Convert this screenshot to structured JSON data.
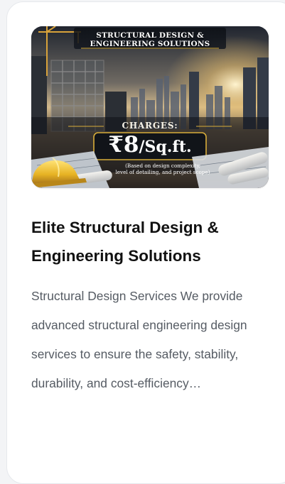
{
  "card": {
    "image": {
      "banner_title_line1": "STRUCTURAL DESIGN &",
      "banner_title_line2": "ENGINEERING SOLUTIONS",
      "charges_label": "CHARGES:",
      "price_amount": "₹8",
      "price_unit": "/Sq.ft.",
      "price_note_line1": "(Based on design complexity,",
      "price_note_line2": "level of detailing, and project scope)"
    },
    "title": "Elite Structural Design & Engineering Solutions",
    "excerpt": "Structural Design Services We provide advanced structural engineering design services to ensure the safety, stability, durability, and cost-efficiency…"
  },
  "colors": {
    "card_background": "#ffffff",
    "page_background": "#f3f4f6",
    "title": "#111111",
    "excerpt": "#555b63",
    "banner_gold": "#d8ad3a"
  },
  "icons": {
    "helmet": "yellow-safety-helmet-illustration",
    "crane": "construction-crane-illustration"
  }
}
